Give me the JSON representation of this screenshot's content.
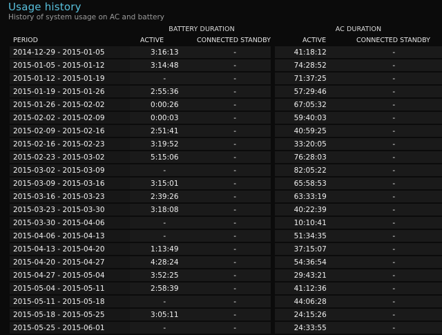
{
  "header": {
    "title": "Usage history",
    "subtitle": "History of system usage on AC and battery"
  },
  "groups": {
    "battery": "BATTERY DURATION",
    "ac": "AC DURATION"
  },
  "columns": {
    "period": "PERIOD",
    "battery_active": "ACTIVE",
    "battery_standby": "CONNECTED STANDBY",
    "ac_active": "ACTIVE",
    "ac_standby": "CONNECTED STANDBY"
  },
  "rows": [
    [
      "2014-12-29 - 2015-01-05",
      "3:16:13",
      "-",
      "41:18:12",
      "-"
    ],
    [
      "2015-01-05 - 2015-01-12",
      "3:14:48",
      "-",
      "74:28:52",
      "-"
    ],
    [
      "2015-01-12 - 2015-01-19",
      "-",
      "-",
      "71:37:25",
      "-"
    ],
    [
      "2015-01-19 - 2015-01-26",
      "2:55:36",
      "-",
      "57:29:46",
      "-"
    ],
    [
      "2015-01-26 - 2015-02-02",
      "0:00:26",
      "-",
      "67:05:32",
      "-"
    ],
    [
      "2015-02-02 - 2015-02-09",
      "0:00:03",
      "-",
      "59:40:03",
      "-"
    ],
    [
      "2015-02-09 - 2015-02-16",
      "2:51:41",
      "-",
      "40:59:25",
      "-"
    ],
    [
      "2015-02-16 - 2015-02-23",
      "3:19:52",
      "-",
      "33:20:05",
      "-"
    ],
    [
      "2015-02-23 - 2015-03-02",
      "5:15:06",
      "-",
      "76:28:03",
      "-"
    ],
    [
      "2015-03-02 - 2015-03-09",
      "-",
      "-",
      "82:05:22",
      "-"
    ],
    [
      "2015-03-09 - 2015-03-16",
      "3:15:01",
      "-",
      "65:58:53",
      "-"
    ],
    [
      "2015-03-16 - 2015-03-23",
      "2:39:26",
      "-",
      "63:33:19",
      "-"
    ],
    [
      "2015-03-23 - 2015-03-30",
      "3:18:08",
      "-",
      "40:22:39",
      "-"
    ],
    [
      "2015-03-30 - 2015-04-06",
      "-",
      "-",
      "10:10:41",
      "-"
    ],
    [
      "2015-04-06 - 2015-04-13",
      "-",
      "-",
      "51:34:35",
      "-"
    ],
    [
      "2015-04-13 - 2015-04-20",
      "1:13:49",
      "-",
      "37:15:07",
      "-"
    ],
    [
      "2015-04-20 - 2015-04-27",
      "4:28:24",
      "-",
      "54:36:54",
      "-"
    ],
    [
      "2015-04-27 - 2015-05-04",
      "3:52:25",
      "-",
      "29:43:21",
      "-"
    ],
    [
      "2015-05-04 - 2015-05-11",
      "2:58:39",
      "-",
      "41:12:36",
      "-"
    ],
    [
      "2015-05-11 - 2015-05-18",
      "-",
      "-",
      "44:06:28",
      "-"
    ],
    [
      "2015-05-18 - 2015-05-25",
      "3:05:11",
      "-",
      "24:15:26",
      "-"
    ],
    [
      "2015-05-25 - 2015-06-01",
      "-",
      "-",
      "24:33:55",
      "-"
    ]
  ]
}
